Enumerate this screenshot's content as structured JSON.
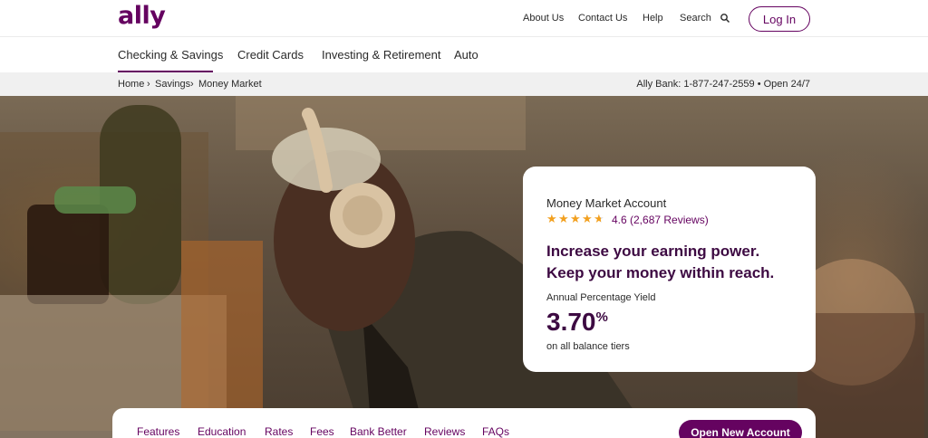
{
  "header": {
    "logo": "ally",
    "links": {
      "about": "About Us",
      "contact": "Contact Us",
      "help": "Help",
      "search": "Search"
    },
    "login_label": "Log In"
  },
  "nav": {
    "items": [
      "Checking & Savings",
      "Credit Cards",
      "Investing & Retirement",
      "Auto"
    ],
    "active": "Checking & Savings"
  },
  "breadcrumb": {
    "items": [
      "Home",
      "Savings",
      "Money Market"
    ],
    "separator": "›",
    "bank_info": "Ally Bank: 1-877-247-2559 • Open 24/7"
  },
  "card": {
    "title": "Money Market Account",
    "rating": "4.6 (2,687 Reviews)",
    "rating_value": 4.6,
    "headline_1": "Increase your earning power.",
    "headline_2": "Keep your money within reach.",
    "apy_label": "Annual Percentage Yield",
    "apy_value": "3.70",
    "apy_unit": "%",
    "apy_note": "on all balance tiers"
  },
  "subnav": {
    "items": [
      "Features",
      "Education",
      "Rates",
      "Fees",
      "Bank Better",
      "Reviews",
      "FAQs"
    ],
    "cta_label": "Open New Account"
  },
  "colors": {
    "brand": "#650360",
    "headline": "#3d0a42",
    "star": "#f2a01f"
  }
}
